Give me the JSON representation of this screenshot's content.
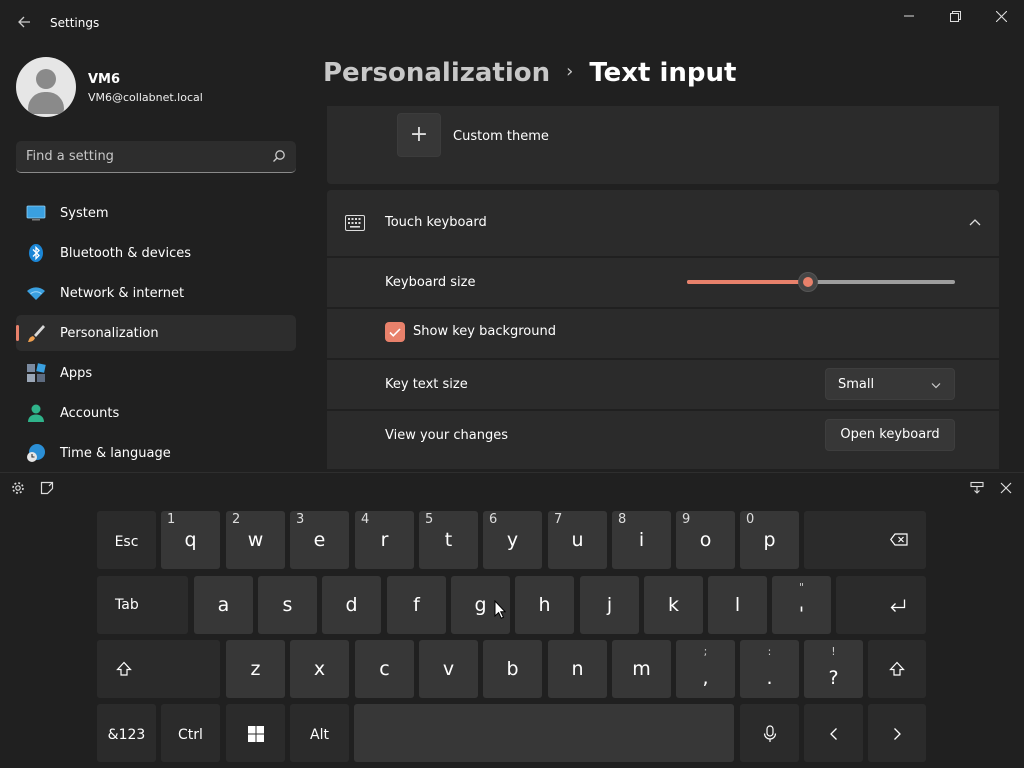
{
  "window": {
    "title": "Settings",
    "controls": {
      "minimize": "minimize-icon",
      "restore": "restore-icon",
      "close": "close-icon"
    }
  },
  "profile": {
    "name": "VM6",
    "email": "VM6@collabnet.local"
  },
  "search": {
    "placeholder": "Find a setting"
  },
  "sidebar": {
    "items": [
      {
        "label": "System",
        "icon": "system-icon"
      },
      {
        "label": "Bluetooth & devices",
        "icon": "bluetooth-icon"
      },
      {
        "label": "Network & internet",
        "icon": "wifi-icon"
      },
      {
        "label": "Personalization",
        "icon": "brush-icon",
        "active": true
      },
      {
        "label": "Apps",
        "icon": "apps-icon"
      },
      {
        "label": "Accounts",
        "icon": "accounts-icon"
      },
      {
        "label": "Time & language",
        "icon": "time-language-icon"
      }
    ]
  },
  "breadcrumb": {
    "parent": "Personalization",
    "current": "Text input"
  },
  "content": {
    "custom_theme": "Custom theme",
    "touch_keyboard": "Touch keyboard",
    "keyboard_size": {
      "label": "Keyboard size",
      "value_fraction": 0.45
    },
    "show_key_background": {
      "label": "Show key background",
      "checked": true
    },
    "key_text_size": {
      "label": "Key text size",
      "value": "Small"
    },
    "view_changes": {
      "label": "View your changes",
      "button": "Open keyboard"
    }
  },
  "keyboard": {
    "row1": {
      "esc": "Esc",
      "letters": [
        {
          "num": "1",
          "ch": "q"
        },
        {
          "num": "2",
          "ch": "w"
        },
        {
          "num": "3",
          "ch": "e"
        },
        {
          "num": "4",
          "ch": "r"
        },
        {
          "num": "5",
          "ch": "t"
        },
        {
          "num": "6",
          "ch": "y"
        },
        {
          "num": "7",
          "ch": "u"
        },
        {
          "num": "8",
          "ch": "i"
        },
        {
          "num": "9",
          "ch": "o"
        },
        {
          "num": "0",
          "ch": "p"
        }
      ]
    },
    "row2": {
      "tab": "Tab",
      "letters": [
        "a",
        "s",
        "d",
        "f",
        "g",
        "h",
        "j",
        "k",
        "l"
      ],
      "apostrophe": {
        "shift": "\"",
        "ch": "'"
      }
    },
    "row3": {
      "letters": [
        "z",
        "x",
        "c",
        "v",
        "b",
        "n",
        "m"
      ],
      "punct": [
        {
          "shift": ";",
          "ch": ","
        },
        {
          "shift": ":",
          "ch": "."
        },
        {
          "shift": "!",
          "ch": "?"
        }
      ]
    },
    "row4": {
      "sym": "&123",
      "ctrl": "Ctrl",
      "alt": "Alt"
    },
    "accent": "#e8816b"
  }
}
